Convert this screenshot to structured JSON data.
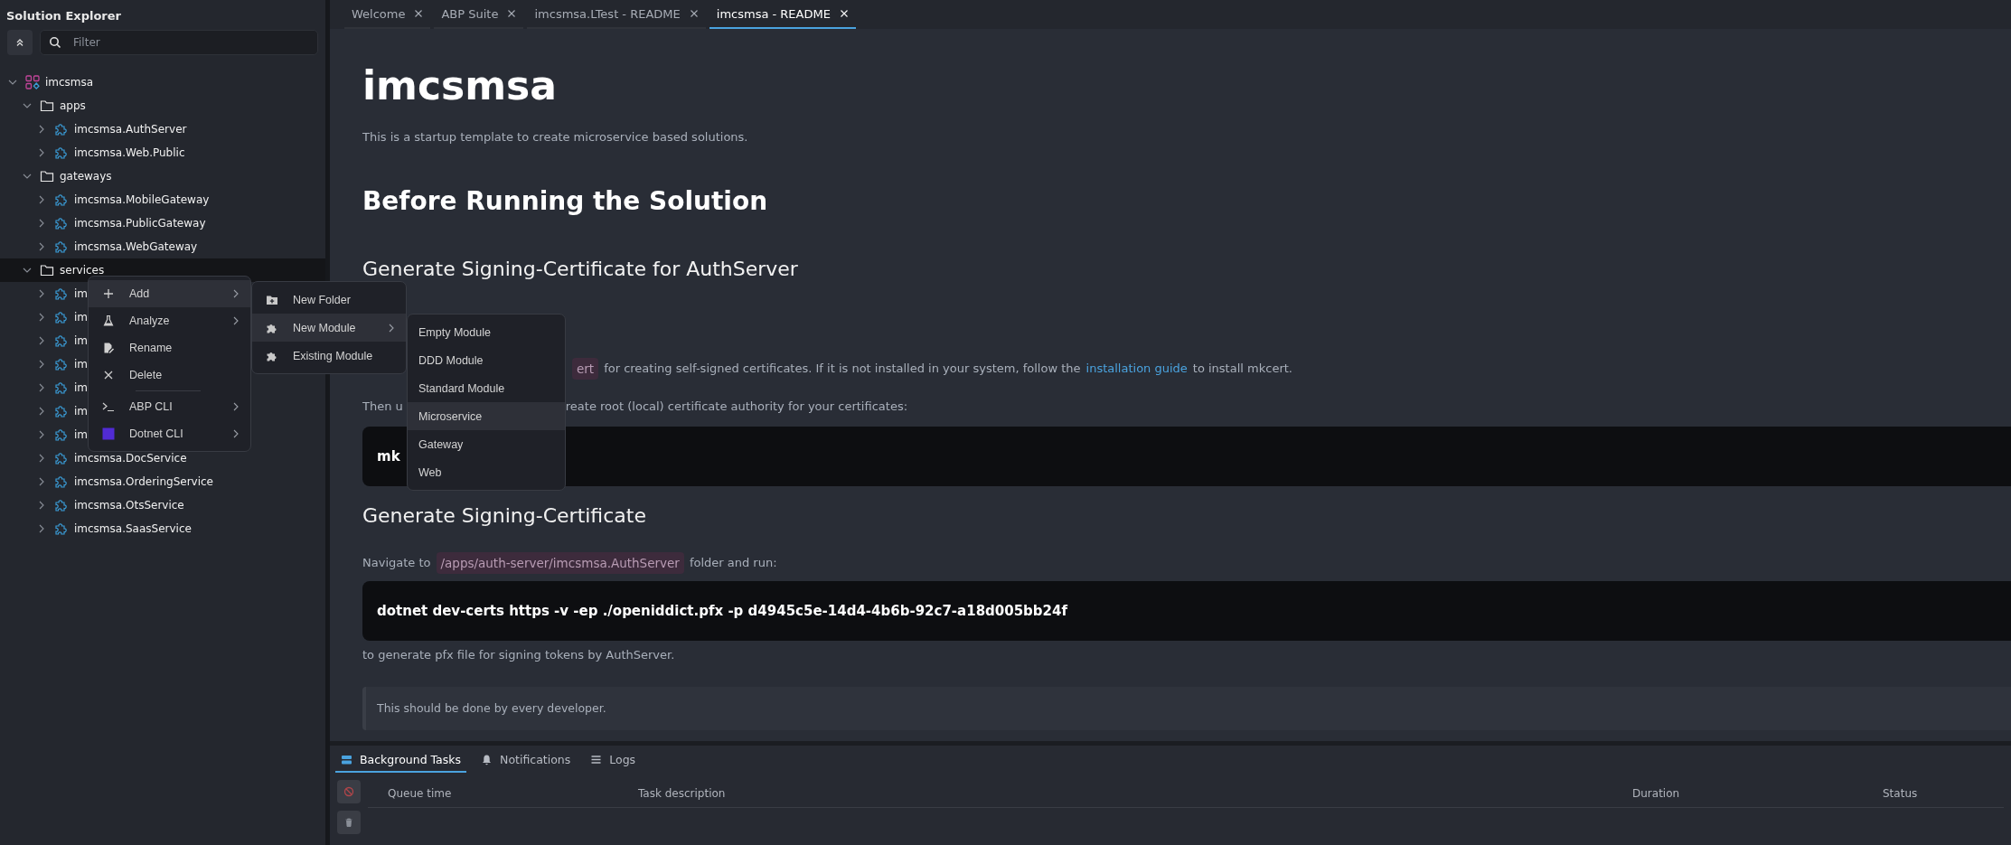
{
  "sidebar": {
    "title": "Solution Explorer",
    "filter": {
      "placeholder": "Filter"
    },
    "tree": [
      {
        "label": "imcsmsa",
        "kind": "solution",
        "expanded": true,
        "selected": false,
        "children": [
          {
            "label": "apps",
            "kind": "folder",
            "expanded": true,
            "selected": false,
            "children": [
              {
                "label": "imcsmsa.AuthServer",
                "kind": "module",
                "expanded": false,
                "selected": false
              },
              {
                "label": "imcsmsa.Web.Public",
                "kind": "module",
                "expanded": false,
                "selected": false
              }
            ]
          },
          {
            "label": "gateways",
            "kind": "folder",
            "expanded": true,
            "selected": false,
            "children": [
              {
                "label": "imcsmsa.MobileGateway",
                "kind": "module",
                "expanded": false,
                "selected": false
              },
              {
                "label": "imcsmsa.PublicGateway",
                "kind": "module",
                "expanded": false,
                "selected": false
              },
              {
                "label": "imcsmsa.WebGateway",
                "kind": "module",
                "expanded": false,
                "selected": false
              }
            ]
          },
          {
            "label": "services",
            "kind": "folder",
            "expanded": true,
            "selected": true,
            "children": [
              {
                "label": "im",
                "kind": "module",
                "expanded": false,
                "selected": false
              },
              {
                "label": "im",
                "kind": "module",
                "expanded": false,
                "selected": false
              },
              {
                "label": "im",
                "kind": "module",
                "expanded": false,
                "selected": false
              },
              {
                "label": "im",
                "kind": "module",
                "expanded": false,
                "selected": false
              },
              {
                "label": "im",
                "kind": "module",
                "expanded": false,
                "selected": false
              },
              {
                "label": "im",
                "kind": "module",
                "expanded": false,
                "selected": false
              },
              {
                "label": "im",
                "kind": "module",
                "expanded": false,
                "selected": false
              },
              {
                "label": "imcsmsa.DocService",
                "kind": "module",
                "expanded": false,
                "selected": false
              },
              {
                "label": "imcsmsa.OrderingService",
                "kind": "module",
                "expanded": false,
                "selected": false
              },
              {
                "label": "imcsmsa.OtsService",
                "kind": "module",
                "expanded": false,
                "selected": false
              },
              {
                "label": "imcsmsa.SaasService",
                "kind": "module",
                "expanded": false,
                "selected": false
              }
            ]
          }
        ]
      }
    ]
  },
  "context_menu": {
    "items": [
      {
        "label": "Add",
        "kind": "plus",
        "selected": true,
        "submenu": {
          "items": [
            {
              "label": "New Folder",
              "kind": "folder",
              "selected": false
            },
            {
              "label": "New Module",
              "kind": "puzzle",
              "selected": true,
              "submenu": {
                "items": [
                  {
                    "label": "Empty Module",
                    "selected": false
                  },
                  {
                    "label": "DDD Module",
                    "selected": false
                  },
                  {
                    "label": "Standard Module",
                    "selected": false
                  },
                  {
                    "label": "Microservice",
                    "selected": true
                  },
                  {
                    "label": "Gateway",
                    "selected": false
                  },
                  {
                    "label": "Web",
                    "selected": false
                  }
                ]
              }
            },
            {
              "label": "Existing Module",
              "kind": "puzzle",
              "selected": false
            }
          ]
        }
      },
      {
        "label": "Analyze",
        "kind": "flask",
        "selected": false,
        "has_submenu": true
      },
      {
        "label": "Rename",
        "kind": "rename",
        "selected": false
      },
      {
        "label": "Delete",
        "kind": "close",
        "selected": false
      },
      {
        "label": "ABP CLI",
        "kind": "terminal",
        "selected": false,
        "has_submenu": true,
        "separator_before": true
      },
      {
        "label": "Dotnet CLI",
        "kind": "dotnet",
        "selected": false,
        "has_submenu": true
      }
    ]
  },
  "editor": {
    "tabs": [
      {
        "label": "Welcome",
        "selected": false
      },
      {
        "label": "ABP Suite",
        "selected": false
      },
      {
        "label": "imcsmsa.LTest - README",
        "selected": false
      },
      {
        "label": "imcsmsa - README",
        "selected": true
      }
    ],
    "document": [
      {
        "kind": "h1",
        "text": "imcsmsa"
      },
      {
        "kind": "p",
        "text": "This is a startup template to create microservice based solutions."
      },
      {
        "kind": "h2",
        "text": "Before Running the Solution"
      },
      {
        "kind": "h3",
        "text": "Generate Signing-Certificate for AuthServer"
      },
      {
        "kind": "tail",
        "segments": [
          {
            "kind": "code",
            "text": "ert"
          },
          {
            "kind": "text",
            "text": "for creating self-signed certificates. If it is not installed in your system, follow the"
          },
          {
            "kind": "link",
            "text": "installation guide"
          },
          {
            "kind": "text",
            "text": "to install mkcert."
          }
        ]
      },
      {
        "kind": "split",
        "parts": [
          "Then u",
          "reate root (local) certificate authority for your certificates:"
        ]
      },
      {
        "kind": "code",
        "text": "mk"
      },
      {
        "kind": "h3",
        "text": "Generate Signing-Certificate"
      },
      {
        "kind": "rich",
        "segments": [
          {
            "kind": "text",
            "text": "Navigate to"
          },
          {
            "kind": "code",
            "text": "/apps/auth-server/imcsmsa.AuthServer"
          },
          {
            "kind": "text",
            "text": "folder and run:"
          }
        ]
      },
      {
        "kind": "code",
        "text": "dotnet dev-certs https -v -ep ./openiddict.pfx -p d4945c5e-14d4-4b6b-92c7-a18d005bb24f"
      },
      {
        "kind": "p",
        "text": "to generate pfx file for signing tokens by AuthServer."
      },
      {
        "kind": "quote",
        "text": "This should be done by every developer."
      }
    ]
  },
  "bottom_panel": {
    "tabs": [
      {
        "label": "Background Tasks",
        "kind": "tasks",
        "selected": true
      },
      {
        "label": "Notifications",
        "kind": "bell",
        "selected": false
      },
      {
        "label": "Logs",
        "kind": "list",
        "selected": false
      }
    ],
    "columns": [
      "Queue time",
      "Task description",
      "Duration",
      "Status"
    ]
  }
}
